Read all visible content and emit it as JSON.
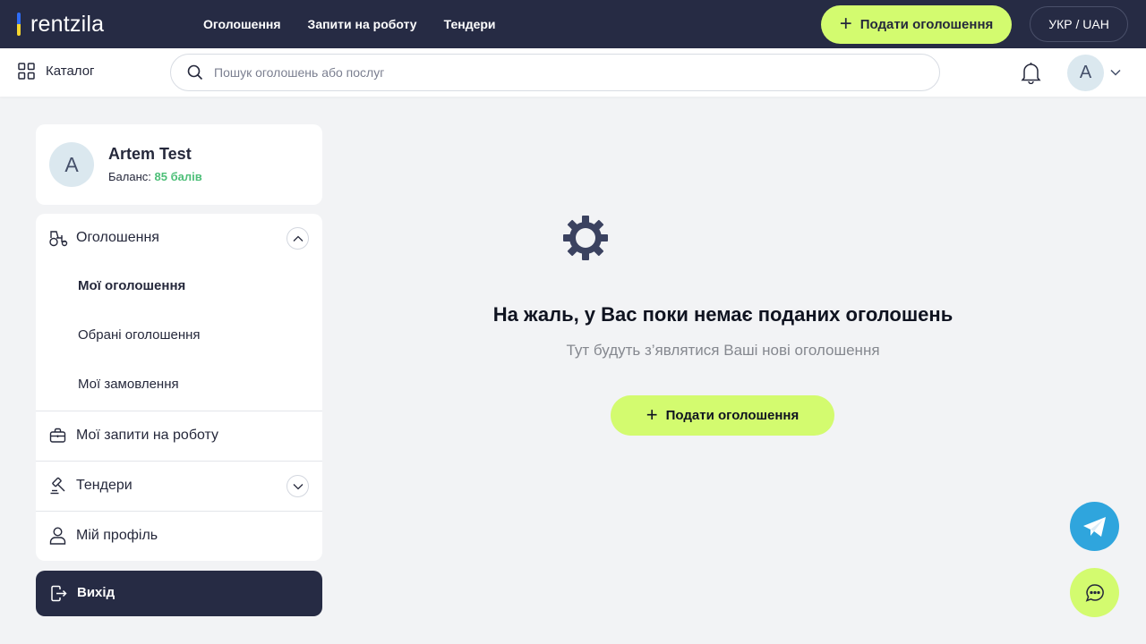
{
  "header": {
    "logo_text": "rentzila",
    "nav": [
      "Оголошення",
      "Запити на роботу",
      "Тендери"
    ],
    "cta_label": "Подати оголошення",
    "lang_label": "УКР / UAH"
  },
  "subheader": {
    "catalog_label": "Каталог",
    "search_placeholder": "Пошук оголошень або послуг",
    "avatar_initial": "А"
  },
  "profile": {
    "avatar_initial": "А",
    "name": "Artem Test",
    "balance_label": "Баланс:",
    "balance_value": "85 балів"
  },
  "sidebar": {
    "ads_label": "Оголошення",
    "ads_subitems": [
      "Мої оголошення",
      "Обрані оголошення",
      "Мої замовлення"
    ],
    "job_requests_label": "Мої запити на роботу",
    "tenders_label": "Тендери",
    "profile_label": "Мій профіль",
    "logout_label": "Вихід"
  },
  "empty_state": {
    "title": "На жаль, у Вас поки немає поданих оголошень",
    "subtitle": "Тут будуть з’являтися Ваші нові оголошення",
    "cta_label": "Подати оголошення"
  },
  "colors": {
    "topbar": "#262b44",
    "accent": "#d3fb6f",
    "balance": "#4dbf78",
    "telegram": "#2fa5dd"
  }
}
